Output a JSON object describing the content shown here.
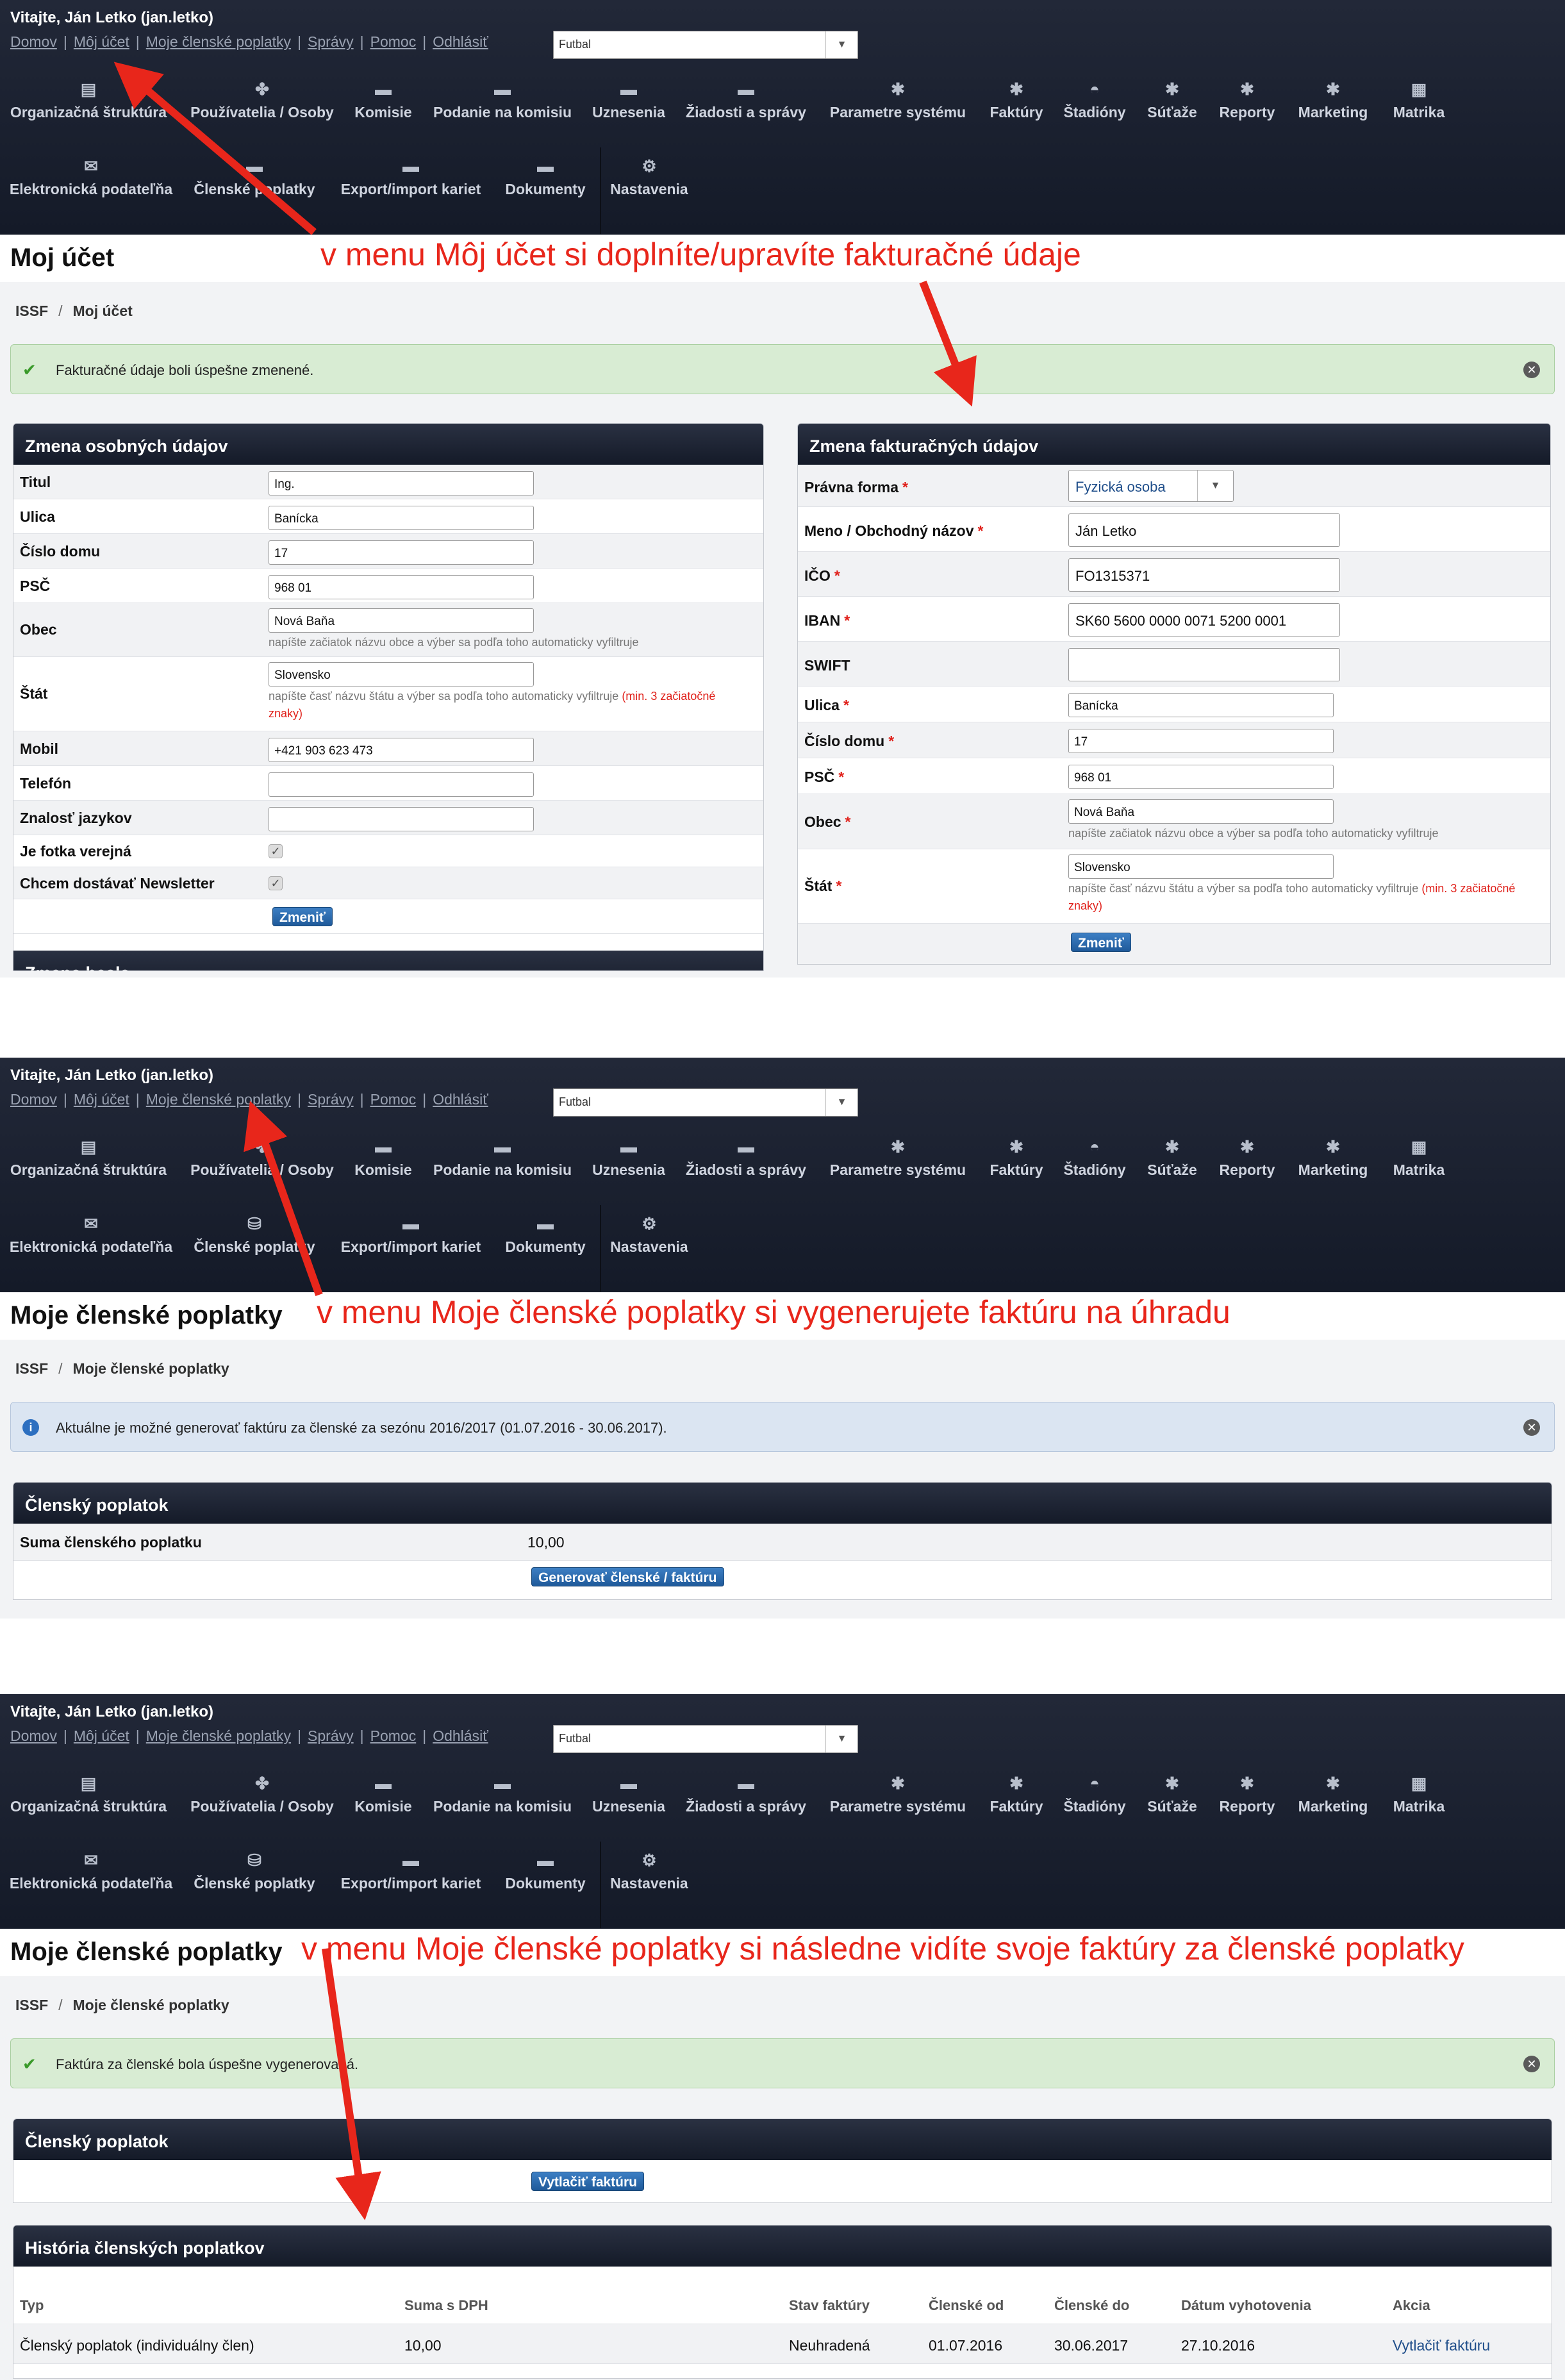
{
  "header": {
    "welcome": "Vitajte, Ján Letko (jan.letko)",
    "links": [
      "Domov",
      "Môj účet",
      "Moje členské poplatky",
      "Správy",
      "Pomoc",
      "Odhlásiť"
    ],
    "sport_select": "Futbal",
    "nav_row1": [
      "Organizačná štruktúra",
      "Používatelia / Osoby",
      "Komisie",
      "Podanie na komisiu",
      "Uznesenia",
      "Žiadosti a správy",
      "Parametre systému",
      "Faktúry",
      "Štadióny",
      "Súťaže",
      "Reporty",
      "Marketing",
      "Matrika"
    ],
    "nav_row2": [
      "Elektronická podateľňa",
      "Členské poplatky",
      "Export/import kariet",
      "Dokumenty",
      "Nastavenia"
    ]
  },
  "panel1": {
    "title": "Moj účet",
    "annotation": "v menu Môj účet si doplníte/upravíte fakturačné údaje",
    "breadcrumb": [
      "ISSF",
      "Moj účet"
    ],
    "alert": "Fakturačné údaje boli úspešne zmenené.",
    "personal": {
      "heading": "Zmena osobných údajov",
      "fields": [
        {
          "label": "Titul",
          "value": "Ing."
        },
        {
          "label": "Ulica",
          "value": "Banícka"
        },
        {
          "label": "Číslo domu",
          "value": "17"
        },
        {
          "label": "PSČ",
          "value": "968 01"
        },
        {
          "label": "Obec",
          "value": "Nová Baňa"
        },
        {
          "label": "Štát",
          "value": "Slovensko"
        },
        {
          "label": "Mobil",
          "value": "+421 903 623 473"
        },
        {
          "label": "Telefón",
          "value": ""
        },
        {
          "label": "Znalosť jazykov",
          "value": ""
        },
        {
          "label": "Je fotka verejná",
          "value": ""
        },
        {
          "label": "Chcem dostávať Newsletter",
          "value": ""
        }
      ],
      "hint_obec": "napíšte začiatok názvu obce a výber sa podľa toho automaticky vyfiltruje",
      "hint_stat": "napíšte časť názvu štátu a výber sa podľa toho automaticky vyfiltruje",
      "hint_stat_red": "(min. 3 začiatočné znaky)",
      "submit": "Zmeniť",
      "next_heading": "Zmena hesla"
    },
    "billing": {
      "heading": "Zmena fakturačných údajov",
      "legal_form_label": "Právna forma",
      "legal_form_value": "Fyzická osoba",
      "name_label": "Meno / Obchodný názov",
      "name_value": "Ján Letko",
      "ico_label": "IČO",
      "ico_value": "FO1315371",
      "iban_label": "IBAN",
      "iban_value": "SK60 5600 0000 0071 5200 0001",
      "swift_label": "SWIFT",
      "swift_value": "",
      "street_label": "Ulica",
      "street_value": "Banícka",
      "house_label": "Číslo domu",
      "house_value": "17",
      "zip_label": "PSČ",
      "zip_value": "968 01",
      "city_label": "Obec",
      "city_value": "Nová Baňa",
      "state_label": "Štát",
      "state_value": "Slovensko",
      "hint_obec": "napíšte začiatok názvu obce a výber sa podľa toho automaticky vyfiltruje",
      "hint_stat": "napíšte časť názvu štátu a výber sa podľa toho automaticky vyfiltruje",
      "hint_stat_red": "(min. 3 začiatočné znaky)",
      "submit": "Zmeniť"
    }
  },
  "panel2": {
    "title": "Moje členské poplatky",
    "annotation": "v menu Moje členské poplatky si vygenerujete faktúru na úhradu",
    "breadcrumb": [
      "ISSF",
      "Moje členské poplatky"
    ],
    "alert": "Aktuálne je možné generovať faktúru za členské za sezónu 2016/2017 (01.07.2016 - 30.06.2017).",
    "box_heading": "Členský poplatok",
    "sum_label": "Suma členského poplatku",
    "sum_value": "10,00",
    "generate_btn": "Generovať členské / faktúru"
  },
  "panel3": {
    "title": "Moje členské poplatky",
    "annotation": "v menu Moje členské poplatky si následne vidíte svoje faktúry za členské poplatky",
    "breadcrumb": [
      "ISSF",
      "Moje členské poplatky"
    ],
    "alert": "Faktúra za členské bola úspešne vygenerovaná.",
    "box_heading": "Členský poplatok",
    "print_btn": "Vytlačiť faktúru",
    "history_heading": "História členských poplatkov",
    "columns": [
      "Typ",
      "Suma s DPH",
      "Stav faktúry",
      "Členské od",
      "Členské do",
      "Dátum vyhotovenia",
      "Akcia"
    ],
    "rows": [
      [
        "Členský poplatok (individuálny člen)",
        "10,00",
        "Neuhradená",
        "01.07.2016",
        "30.06.2017",
        "27.10.2016",
        "Vytlačiť faktúru"
      ]
    ]
  },
  "colors": {
    "annotation": "#e8261b",
    "header_bg": "#1b2130",
    "success_bg": "#d8ecd3",
    "info_bg": "#dbe5f2",
    "button": "#2b6aae"
  }
}
